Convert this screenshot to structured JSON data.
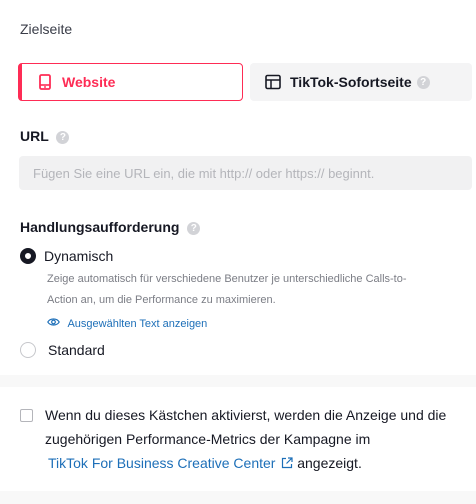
{
  "destination": {
    "section_title": "Zielseite",
    "options": [
      {
        "label": "Website",
        "icon": "mobile-icon",
        "selected": true
      },
      {
        "label": "TikTok-Sofortseite",
        "icon": "page-layout-icon",
        "selected": false
      }
    ]
  },
  "url": {
    "label": "URL",
    "value": "",
    "placeholder": "Fügen Sie eine URL ein, die mit http:// oder https:// beginnt."
  },
  "cta": {
    "label": "Handlungsaufforderung",
    "options": [
      {
        "label": "Dynamisch",
        "selected": true
      },
      {
        "label": "Standard",
        "selected": false
      }
    ],
    "dynamic_desc_1": "Zeige automatisch für verschiedene Benutzer je unterschiedliche Calls-to-",
    "dynamic_desc_2": "Action an, um die Performance zu maximieren.",
    "show_text_link": "Ausgewählten Text anzeigen"
  },
  "consent": {
    "checked": false,
    "line1": "Wenn du dieses Kästchen aktivierst, werden die Anzeige und die",
    "line2": "zugehörigen Performance-Metrics der Kampagne im",
    "link": "TikTok For Business Creative Center",
    "suffix": "angezeigt."
  },
  "colors": {
    "accent": "#fe2c55",
    "link": "#1d6fb8",
    "text": "#161823"
  }
}
